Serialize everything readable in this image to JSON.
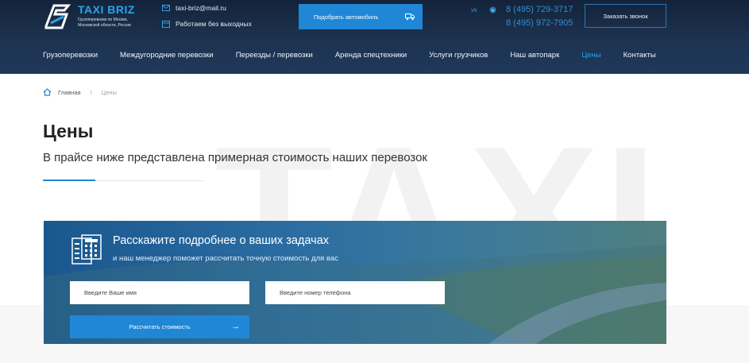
{
  "header": {
    "brand": "TAXI BRIZ",
    "brand_tagline": "Грузоперевозки по Москве, Московской области, России",
    "email": "taxi-briz@mail.ru",
    "schedule": "Работаем без выходных",
    "pick_car_label": "Подобрать автомобиль",
    "phones": [
      "8 (495) 729-3717",
      "8 (495) 972-7905"
    ],
    "callback_label": "Заказать звонок"
  },
  "nav": {
    "items": [
      {
        "label": "Грузоперевозки",
        "active": false
      },
      {
        "label": "Междугородние перевозки",
        "active": false
      },
      {
        "label": "Переезды / перевозки",
        "active": false
      },
      {
        "label": "Аренда спецтехники",
        "active": false
      },
      {
        "label": "Услуги грузчиков",
        "active": false
      },
      {
        "label": "Наш автопарк",
        "active": false
      },
      {
        "label": "Цены",
        "active": true
      },
      {
        "label": "Контакты",
        "active": false
      }
    ]
  },
  "breadcrumb": {
    "home": "Главная",
    "separator": "\\",
    "current": "Цены"
  },
  "page": {
    "title": "Цены",
    "subtitle": "В прайсе ниже представлена примерная стоимость наших перевозок",
    "watermark": "TAXI"
  },
  "form": {
    "title": "Расскажите подробнее о ваших задачах",
    "subtitle": "и наш менеджер поможет рассчитать точную стоимость для вас",
    "name_placeholder": "Введите Ваше имя",
    "phone_placeholder": "Введите номер телефона",
    "submit_label": "Рассчитать стоимость"
  },
  "colors": {
    "accent": "#1f87d6",
    "header_bg": "#1a2e48",
    "active_nav": "#2aa3e8"
  },
  "icons": [
    "logo-icon",
    "mail-icon",
    "calendar-icon",
    "truck-icon",
    "vk-icon",
    "whatsapp-icon",
    "home-icon",
    "calculator-icon",
    "arrow-right-icon"
  ]
}
